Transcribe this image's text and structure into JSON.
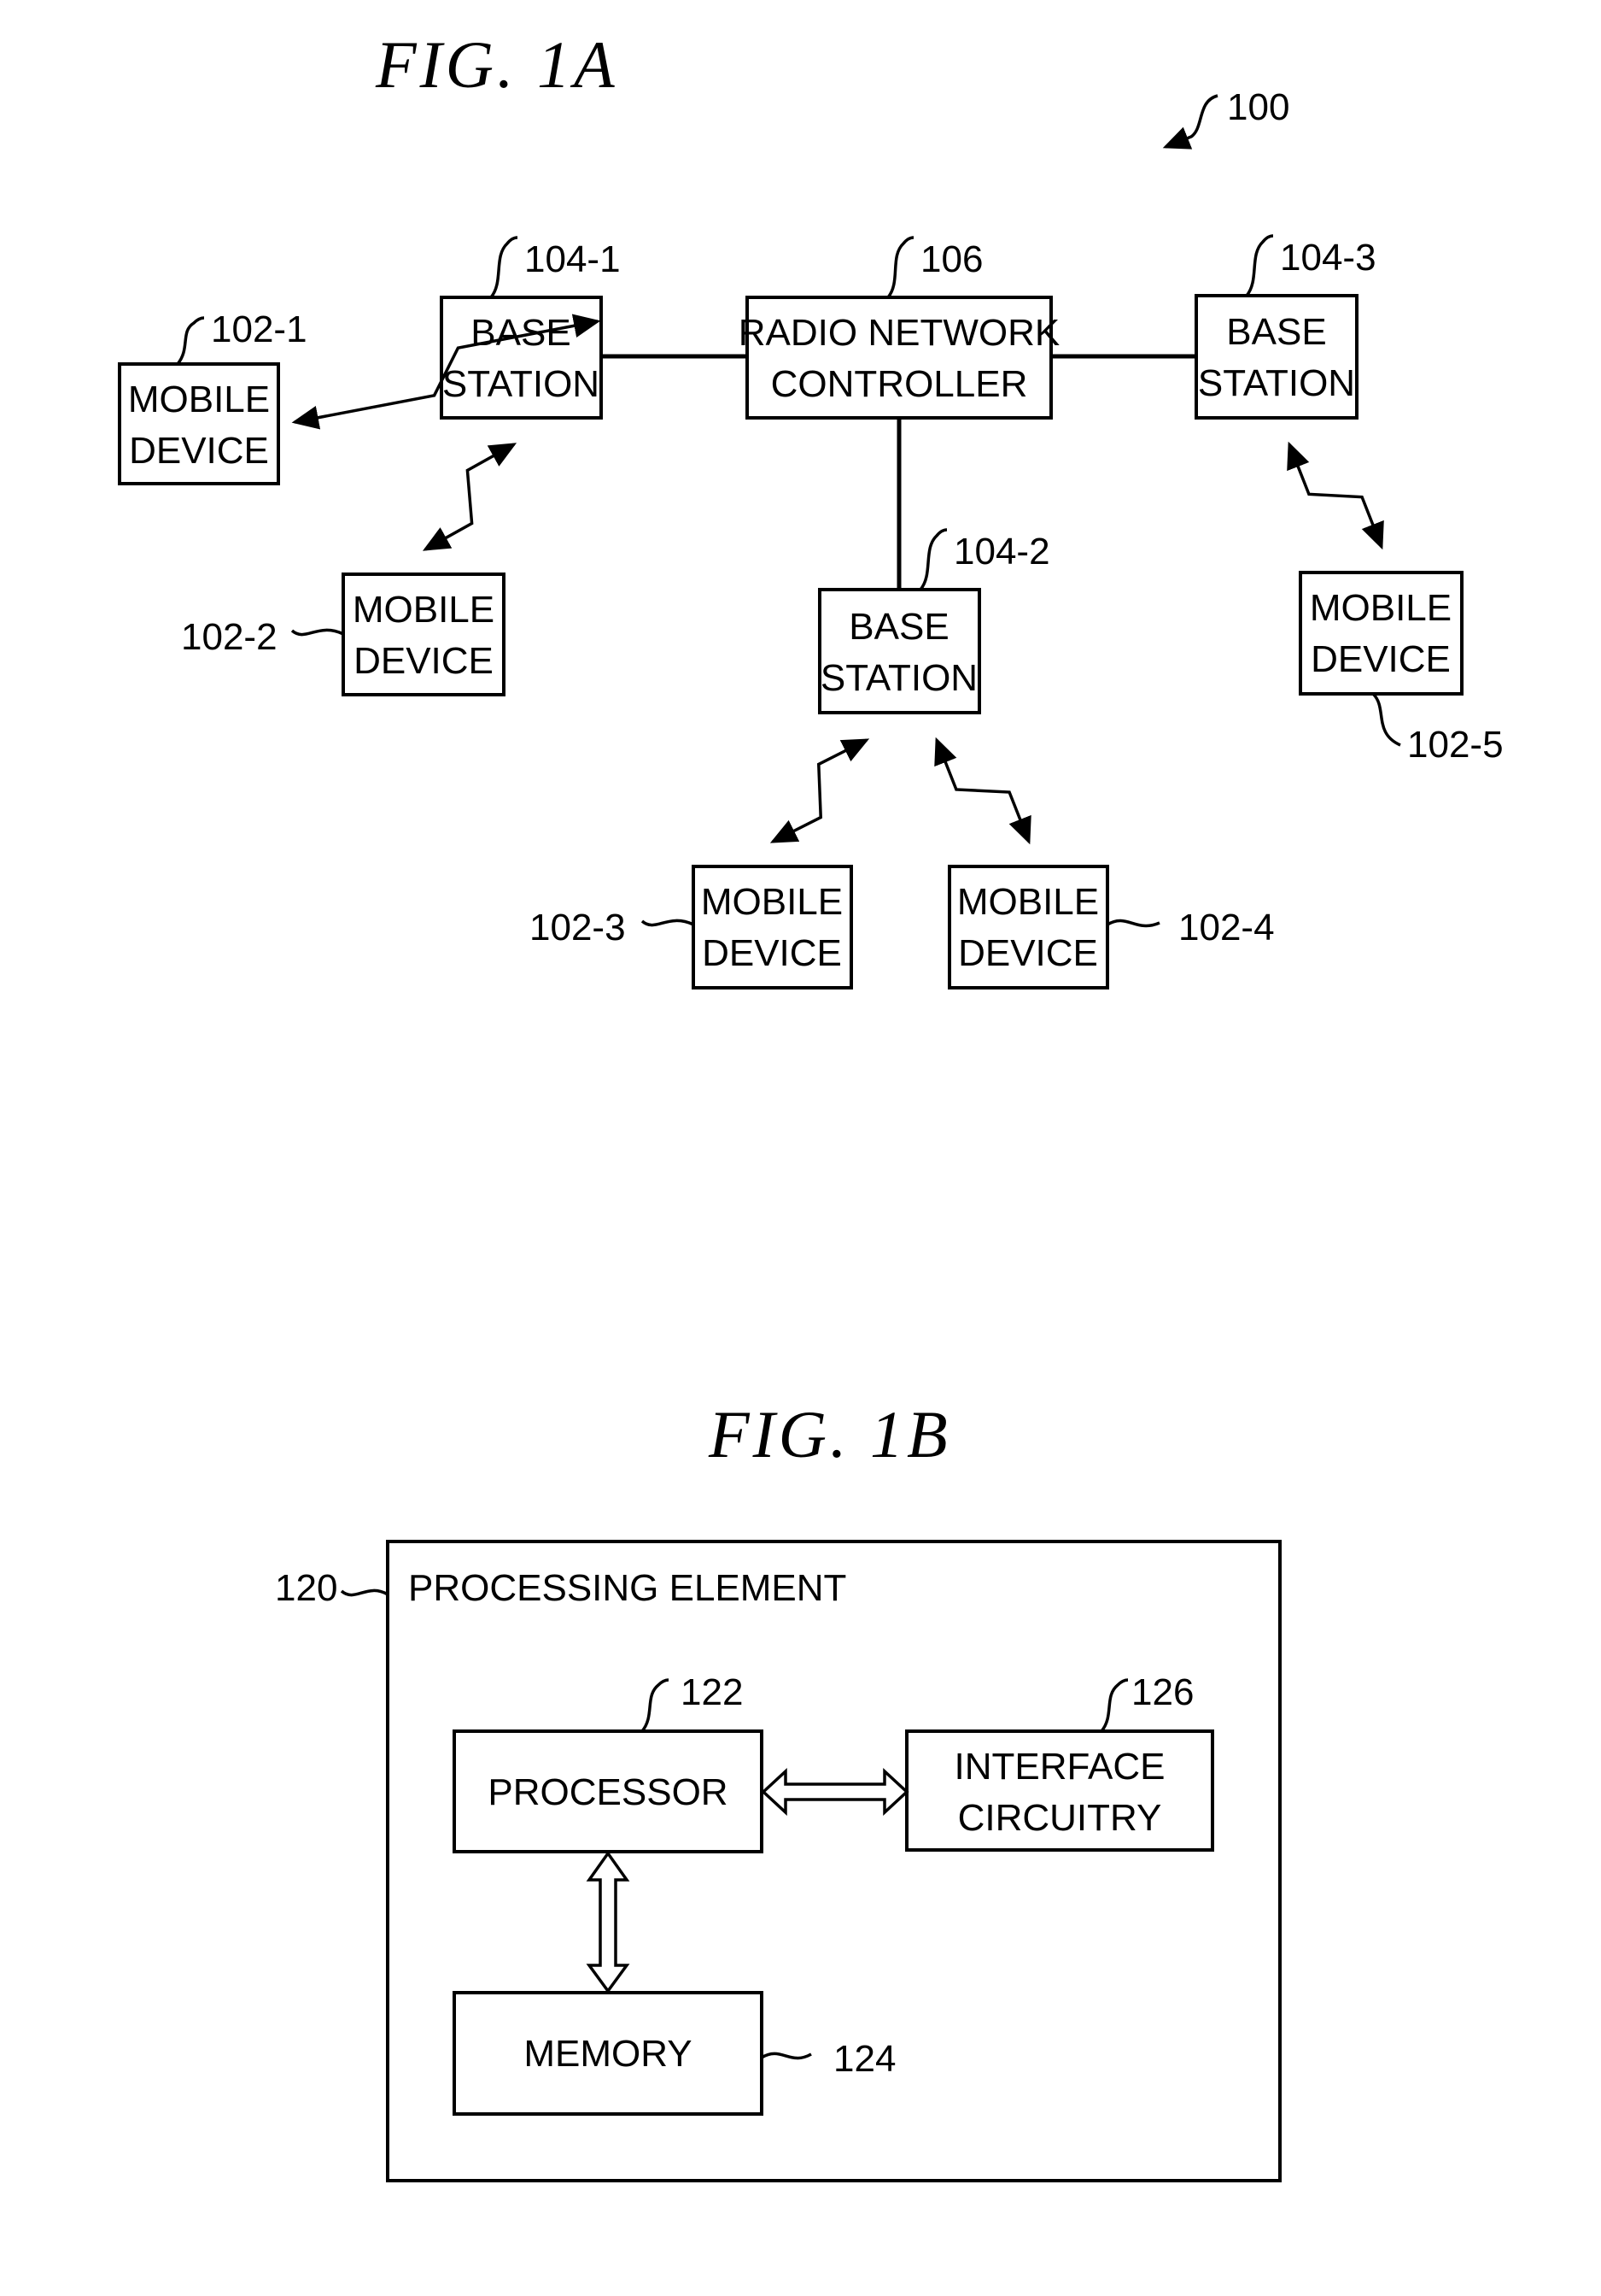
{
  "fig1a": {
    "title": "FIG.  1A",
    "system_ref": "100",
    "nodes": {
      "rnc": {
        "ref": "106",
        "line1": "RADIO NETWORK",
        "line2": "CONTROLLER"
      },
      "bs1": {
        "ref": "104-1",
        "line1": "BASE",
        "line2": "STATION"
      },
      "bs2": {
        "ref": "104-2",
        "line1": "BASE",
        "line2": "STATION"
      },
      "bs3": {
        "ref": "104-3",
        "line1": "BASE",
        "line2": "STATION"
      },
      "md1": {
        "ref": "102-1",
        "line1": "MOBILE",
        "line2": "DEVICE"
      },
      "md2": {
        "ref": "102-2",
        "line1": "MOBILE",
        "line2": "DEVICE"
      },
      "md3": {
        "ref": "102-3",
        "line1": "MOBILE",
        "line2": "DEVICE"
      },
      "md4": {
        "ref": "102-4",
        "line1": "MOBILE",
        "line2": "DEVICE"
      },
      "md5": {
        "ref": "102-5",
        "line1": "MOBILE",
        "line2": "DEVICE"
      }
    },
    "wired_links": [
      [
        "bs1",
        "rnc"
      ],
      [
        "rnc",
        "bs3"
      ],
      [
        "rnc",
        "bs2"
      ]
    ],
    "wireless_links": [
      [
        "bs1",
        "md1"
      ],
      [
        "bs1",
        "md2"
      ],
      [
        "bs2",
        "md3"
      ],
      [
        "bs2",
        "md4"
      ],
      [
        "bs3",
        "md5"
      ]
    ]
  },
  "fig1b": {
    "title": "FIG.  1B",
    "container": {
      "ref": "120",
      "label": "PROCESSING  ELEMENT"
    },
    "processor": {
      "ref": "122",
      "label": "PROCESSOR"
    },
    "memory": {
      "ref": "124",
      "label": "MEMORY"
    },
    "interface": {
      "ref": "126",
      "line1": "INTERFACE",
      "line2": "CIRCUITRY"
    }
  }
}
